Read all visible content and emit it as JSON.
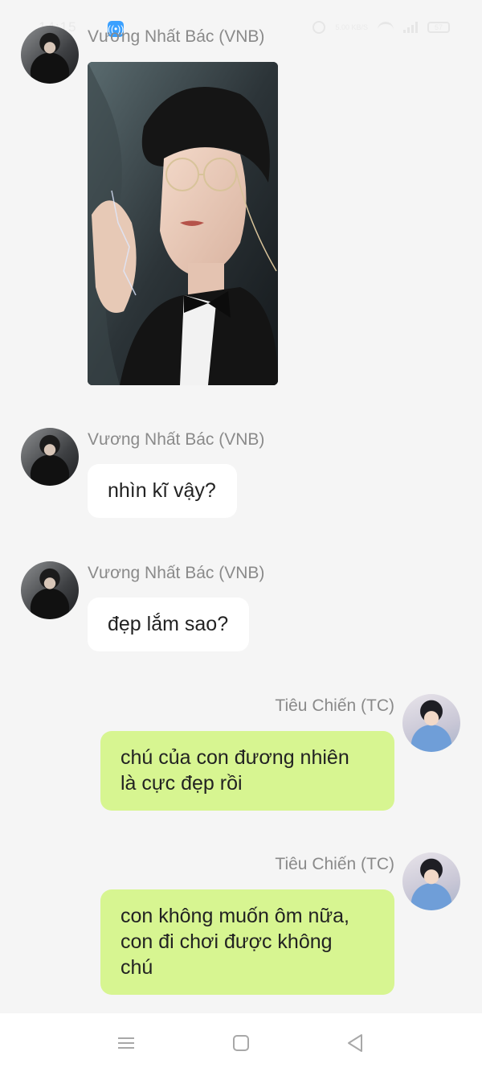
{
  "status_bar": {
    "time": "14:15",
    "notification_icon": "hotspot-icon",
    "net_speed": "5.00 KB/S",
    "battery": "57"
  },
  "messages": [
    {
      "sender": "Vương Nhất Bác (VNB)",
      "type": "image",
      "image_icon": "photo-man-with-glasses"
    },
    {
      "sender": "Vương Nhất Bác (VNB)",
      "type": "text",
      "text": "nhìn kĩ vậy?"
    },
    {
      "sender": "Vương Nhất Bác (VNB)",
      "type": "text",
      "text": "đẹp lắm sao?"
    },
    {
      "sender": "Tiêu Chiến (TC)",
      "type": "text",
      "text_lines": [
        "chú của con đương nhiên",
        "là cực đẹp rồi"
      ]
    },
    {
      "sender": "Tiêu Chiến (TC)",
      "type": "text",
      "text_lines": [
        "con không muốn ôm nữa,",
        "con đi chơi được không",
        "chú"
      ]
    }
  ],
  "colors": {
    "background": "#f5f5f5",
    "incoming_bubble": "#ffffff",
    "outgoing_bubble": "#d7f591",
    "sender_name": "#8a8a8a"
  },
  "nav_bar": {
    "menu_icon": "menu-icon",
    "home_icon": "home-square-icon",
    "back_icon": "back-triangle-icon"
  }
}
